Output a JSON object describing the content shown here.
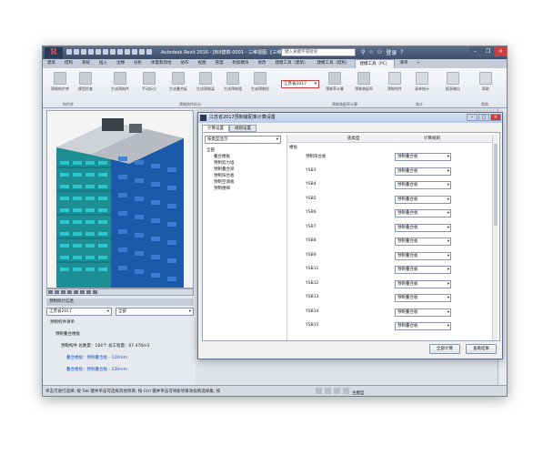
{
  "titlebar": {
    "app_logo": "R",
    "title": "Autodesk Revit 2016 -  [Bill建筑-0001 - 三维视图: {三维}]",
    "search_placeholder": "键入关键字或短语",
    "user": "登录",
    "help": "?"
  },
  "tabs": [
    "建筑",
    "结构",
    "系统",
    "插入",
    "注释",
    "分析",
    "体量和场地",
    "协作",
    "视图",
    "管理",
    "附加模块",
    "修改",
    "建模工具（建筑）",
    "建模工具（结构）",
    "建模工具（PC）",
    "清单",
    "»"
  ],
  "active_tab": "建模工具（PC）",
  "ribbon": {
    "buttons": [
      "预制构件库",
      "模型检查",
      "生成预制件",
      "手动拆分",
      "生成叠合板",
      "生成预制梁",
      "生成预制墙",
      "生成预制柱",
      "",
      "预制率计算",
      "预制装配率",
      "预制构件",
      "清单统计",
      "报表输出",
      "帮助"
    ],
    "standard_dropdown": "江苏省2017",
    "groups": [
      "构件库",
      "预制构件拆分",
      "预制装配率计算",
      "统计",
      "帮助"
    ]
  },
  "left_panel": {
    "props_title": "预制统计信息",
    "select_left": "江苏省2017",
    "select_right": "全部",
    "tree": [
      {
        "text": "预制构件清单",
        "indent": 0,
        "blue": false
      },
      {
        "text": "预制叠合楼板",
        "indent": 1,
        "blue": false
      },
      {
        "text": "预制构件  总数量：184个  总工程量：67.470m3",
        "indent": 2,
        "blue": false
      },
      {
        "text": "叠合楼板：预制叠合板 - 120mm",
        "indent": 3,
        "blue": true
      },
      {
        "text": "叠合楼板：预制叠合板 - 130mm",
        "indent": 3,
        "blue": true
      }
    ]
  },
  "statusbar": {
    "text": "单击可进行选择; 按 Tab 键并单击可选择其他项目; 按 Ctrl 键并单击可将新项目添加到选择集; 按",
    "zoom": "主模型"
  },
  "dialog": {
    "title": "江苏省2017预制装配率计算设置",
    "tabs": [
      "计算设置",
      "规则设置"
    ],
    "active_tab": "计算设置",
    "filter": "按类型显示",
    "tree": [
      "全部",
      "叠合楼板",
      "预制剪力墙",
      "预制叠合梁",
      "预制阳台板",
      "预制空调板",
      "预制楼梯"
    ],
    "column_type": "族类型",
    "column_method": "计算规则",
    "group_label": "楼板",
    "rows": [
      {
        "name": "预制阳台板",
        "method": "预制叠合板"
      },
      {
        "name": "YSB3",
        "method": "预制叠合板"
      },
      {
        "name": "YSB4",
        "method": "预制叠合板"
      },
      {
        "name": "YSB5",
        "method": "预制叠合板"
      },
      {
        "name": "YSB6",
        "method": "预制叠合板"
      },
      {
        "name": "YSB7",
        "method": "预制叠合板"
      },
      {
        "name": "YSB8",
        "method": "预制叠合板"
      },
      {
        "name": "YSB9",
        "method": "预制叠合板"
      },
      {
        "name": "YSB11",
        "method": "预制叠合板"
      },
      {
        "name": "YSB12",
        "method": "预制叠合板"
      },
      {
        "name": "YSB13",
        "method": "预制叠合板"
      },
      {
        "name": "YSB14",
        "method": "预制叠合板"
      },
      {
        "name": "YSB15",
        "method": "预制叠合板"
      }
    ],
    "btn_calc": "全部计算",
    "btn_result": "查看结果"
  }
}
